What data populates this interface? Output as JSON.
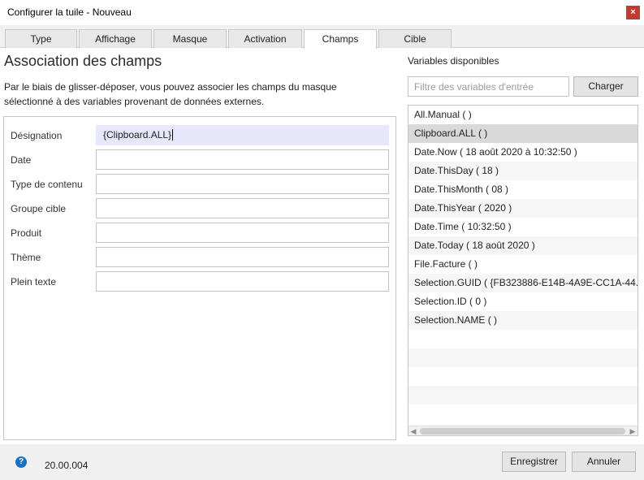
{
  "window": {
    "title": "Configurer la tuile - Nouveau",
    "close_glyph": "×"
  },
  "tabs": [
    {
      "label": "Type"
    },
    {
      "label": "Affichage"
    },
    {
      "label": "Masque"
    },
    {
      "label": "Activation"
    },
    {
      "label": "Champs",
      "active": true
    },
    {
      "label": "Cible"
    }
  ],
  "mapping": {
    "title": "Association des champs",
    "description": "Par le biais de glisser-déposer, vous pouvez associer les champs du masque sélectionné à des variables provenant de données externes.",
    "fields": [
      {
        "label": "Désignation",
        "value": "{Clipboard.ALL}"
      },
      {
        "label": "Date",
        "value": ""
      },
      {
        "label": "Type de contenu",
        "value": ""
      },
      {
        "label": "Groupe cible",
        "value": ""
      },
      {
        "label": "Produit",
        "value": ""
      },
      {
        "label": "Thème",
        "value": ""
      },
      {
        "label": "Plein texte",
        "value": ""
      }
    ]
  },
  "variables": {
    "title": "Variables disponibles",
    "filter_placeholder": "Filtre des variables d'entrée",
    "load_label": "Charger",
    "items": [
      "All.Manual (  )",
      "Clipboard.ALL (  )",
      "Date.Now ( 18 août 2020 à 10:32:50 )",
      "Date.ThisDay ( 18 )",
      "Date.ThisMonth ( 08 )",
      "Date.ThisYear ( 2020 )",
      "Date.Time ( 10:32:50 )",
      "Date.Today ( 18 août 2020 )",
      "File.Facture (  )",
      "Selection.GUID ( {FB323886-E14B-4A9E-CC1A-44... )",
      "Selection.ID ( 0 )",
      "Selection.NAME (  )"
    ],
    "selected_index": 1
  },
  "footer": {
    "help_glyph": "?",
    "version": "20.00.004",
    "save_label": "Enregistrer",
    "cancel_label": "Annuler"
  }
}
